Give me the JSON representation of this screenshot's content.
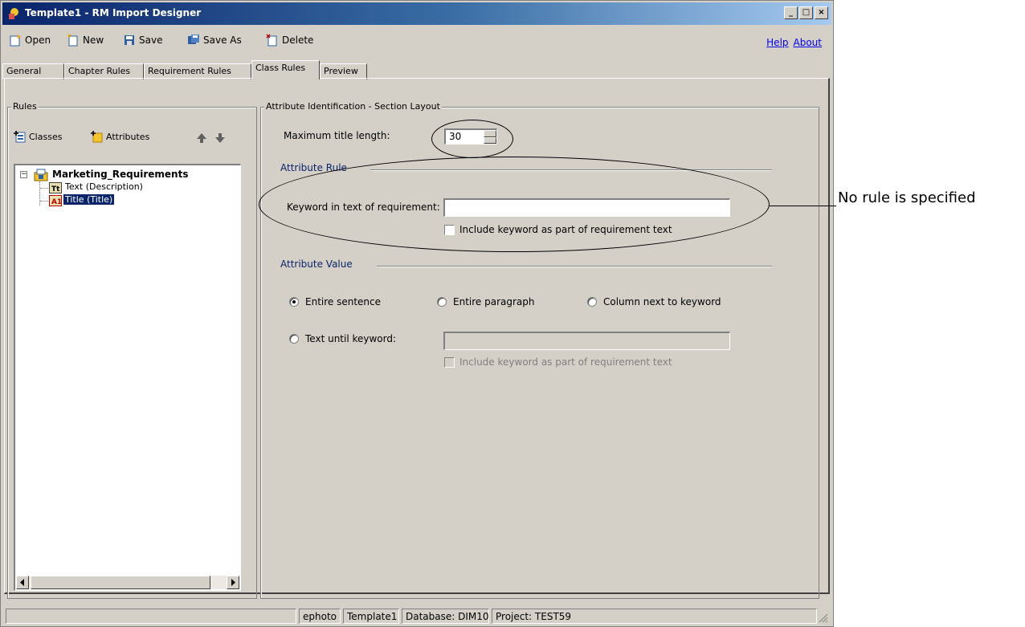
{
  "window": {
    "title": "Template1 - RM Import Designer",
    "controls": [
      "_",
      "□",
      "×"
    ]
  },
  "toolbar": {
    "open": "Open",
    "new": "New",
    "save": "Save",
    "save_as": "Save As",
    "delete": "Delete",
    "help": "Help",
    "about": "About"
  },
  "tabs": [
    "General",
    "Chapter Rules",
    "Requirement Rules",
    "Class Rules",
    "Preview"
  ],
  "active_tab": "Class Rules",
  "rules": {
    "legend": "Rules",
    "classes_button": "Classes",
    "attributes_button": "Attributes",
    "tree": {
      "root": "Marketing_Requirements",
      "children": [
        "Text (Description)",
        "Title (Title)"
      ],
      "selected": "Title (Title)"
    }
  },
  "layout_group": {
    "legend": "Attribute Identification - Section Layout",
    "max_title_label": "Maximum title length:",
    "max_title_value": "30",
    "attribute_rule": {
      "title": "Attribute Rule",
      "keyword_label": "Keyword in text of requirement:",
      "keyword_value": "",
      "include_keyword": "Include keyword as part of requirement text",
      "include_checked": false
    },
    "attribute_value": {
      "title": "Attribute Value",
      "options": [
        "Entire sentence",
        "Entire paragraph",
        "Column next to keyword",
        "Text until keyword:"
      ],
      "selected": "Entire sentence",
      "text_until_value": "",
      "include_keyword": "Include keyword as part of requirement text"
    }
  },
  "status": {
    "user": "ephoto",
    "template": "Template1",
    "database": "Database: DIM10",
    "project": "Project: TEST59"
  },
  "annotation": "No rule is specified"
}
